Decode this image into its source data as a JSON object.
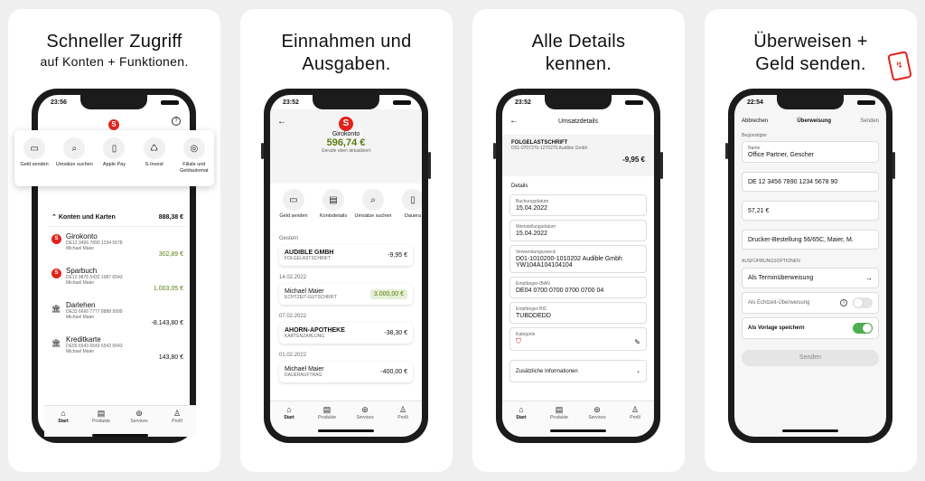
{
  "panels": [
    {
      "line1": "Schneller Zugriff",
      "line2": "auf Konten + Funktionen."
    },
    {
      "line1": "Einnahmen und",
      "line2": "Ausgaben."
    },
    {
      "line1": "Alle Details",
      "line2": "kennen."
    },
    {
      "line1": "Überweisen +",
      "line2": "Geld senden."
    }
  ],
  "tabbar": {
    "start": "Start",
    "produkte": "Produkte",
    "services": "Services",
    "profil": "Profil"
  },
  "s1": {
    "time": "23:56",
    "quick": [
      {
        "label": "Geld senden"
      },
      {
        "label": "Umsätze suchen"
      },
      {
        "label": "Apple Pay"
      },
      {
        "label": "S-Invest"
      },
      {
        "label": "Filiale und Geldautomat"
      }
    ],
    "section": {
      "title": "Konten und Karten",
      "total": "888,38 €"
    },
    "accounts": [
      {
        "name": "Girokonto",
        "iban": "DE12 3456 7890 1234 5678",
        "owner": "Michael Maier",
        "balance": "302,89 €"
      },
      {
        "name": "Sparbuch",
        "iban": "DE12 9876 5432 1987 6543",
        "owner": "Michael Maier",
        "balance": "1.003,05 €"
      },
      {
        "name": "Darlehen",
        "iban": "DE33 6666 7777 8888 9999",
        "owner": "Michael Maier",
        "balance": "-8.143,80 €"
      },
      {
        "name": "Kreditkarte",
        "iban": "DE55 6543 6543 6543 6543",
        "owner": "Michael Maier",
        "balance": "143,80 €"
      }
    ]
  },
  "s2": {
    "time": "23:52",
    "title": "Girokonto",
    "balance": "596,74 €",
    "updated": "Gerade eben aktualisiert",
    "actions": [
      {
        "label": "Geld senden"
      },
      {
        "label": "Kontodetails"
      },
      {
        "label": "Umsätze suchen"
      },
      {
        "label": "Dauera"
      }
    ],
    "groups": [
      {
        "date": "Gestern",
        "items": [
          {
            "name": "AUDIBLE GMBH",
            "type": "FOLGELASTSCHRIFT",
            "amount": "-9,95 €"
          }
        ]
      },
      {
        "date": "14.02.2022",
        "items": [
          {
            "name": "Michael Maier",
            "type": "ECHTZEIT-GUTSCHRIFT",
            "amount": "3.000,00 €"
          }
        ]
      },
      {
        "date": "07.02.2022",
        "items": [
          {
            "name": "AHORN-APOTHEKE",
            "type": "KARTENZAHLUNG",
            "amount": "-38,30 €"
          }
        ]
      },
      {
        "date": "01.02.2022",
        "items": [
          {
            "name": "Michael Maier",
            "type": "DAUERAUFTRAG",
            "amount": "-400,00 €"
          }
        ]
      }
    ]
  },
  "s3": {
    "time": "23:52",
    "title": "Umsatzdetails",
    "type": "FOLGELASTSCHRIFT",
    "ref": "D01-0707270-1270270 Audible Gmbh",
    "amount": "-9,95 €",
    "details_label": "Details",
    "fields": [
      {
        "label": "Buchungsdatum",
        "value": "15.04.2022"
      },
      {
        "label": "Wertstellungsdatum",
        "value": "15.04.2022"
      },
      {
        "label": "Verwendungszweck",
        "value": "D01-1010200-1010202 Audible Gmbh YW104A104104104"
      },
      {
        "label": "Empfänger-IBAN",
        "value": "DE04 0700 0700 0700 0700 04"
      },
      {
        "label": "Empfänger-BIC",
        "value": "TUBDDEDD"
      }
    ],
    "category_label": "Kategorie",
    "extra": "Zusätzliche Informationen"
  },
  "s4": {
    "time": "22:54",
    "cancel": "Abbrechen",
    "title": "Überweisung",
    "send": "Senden",
    "beneficiary_label": "Begünstigter",
    "name_label": "Name",
    "name": "Office Partner, Gescher",
    "iban": "DE 12 3456 7890 1234 5678 90",
    "amount": "57,21 €",
    "purpose": "Drucker-Bestellung 56/65C, Maier, M.",
    "options_label": "AUSFÜHRUNGSOPTIONEN",
    "termin": "Als Terminüberweisung",
    "echtzeit": "Als Echtzeit-Überweisung",
    "vorlage": "Als Vorlage speichern",
    "button": "Senden"
  },
  "colors": {
    "brand_red": "#e2231a",
    "green": "#4caf50",
    "positive_amount": "#5a7d10",
    "positive_bg": "#e6efd6"
  }
}
